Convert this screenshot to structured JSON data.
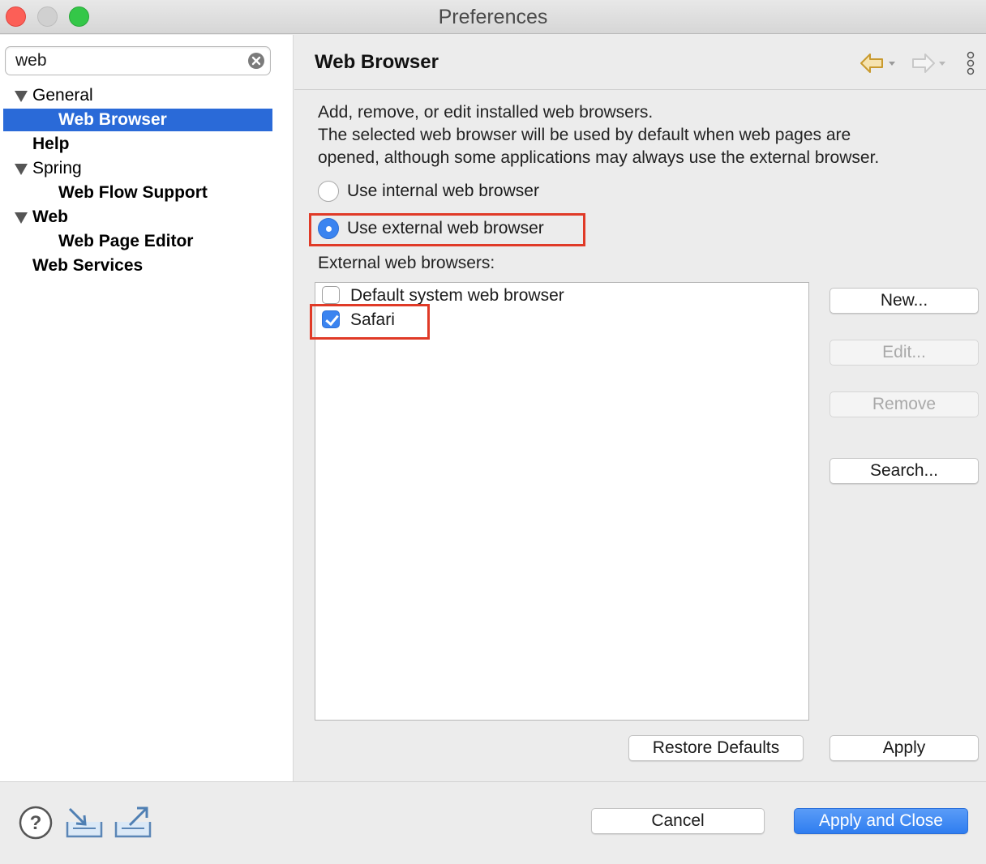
{
  "window": {
    "title": "Preferences"
  },
  "sidebar": {
    "search": {
      "value": "web"
    },
    "items": [
      {
        "label": "General"
      },
      {
        "label": "Web Browser"
      },
      {
        "label": "Help"
      },
      {
        "label": "Spring"
      },
      {
        "label": "Web Flow Support"
      },
      {
        "label": "Web"
      },
      {
        "label": "Web Page Editor"
      },
      {
        "label": "Web Services"
      }
    ],
    "selected": "Web Browser"
  },
  "page": {
    "title": "Web Browser",
    "description_line1": "Add, remove, or edit installed web browsers.",
    "description_line2": "The selected web browser will be used by default when web pages are",
    "description_line3": "opened, although some applications may always use the external browser.",
    "radio_internal": "Use internal web browser",
    "radio_external": "Use external web browser",
    "selected_radio": "Use external web browser",
    "browsers_label": "External web browsers:",
    "browsers": [
      {
        "name": "Default system web browser",
        "checked": false
      },
      {
        "name": "Safari",
        "checked": true
      }
    ]
  },
  "buttons": {
    "new": "New...",
    "edit": "Edit...",
    "remove": "Remove",
    "search": "Search...",
    "restore_defaults": "Restore Defaults",
    "apply": "Apply",
    "cancel": "Cancel",
    "apply_and_close": "Apply and Close"
  },
  "colors": {
    "selection": "#2a6ad8",
    "accent": "#3b84f0",
    "highlight_annotation": "#e03a27"
  },
  "icons": {
    "back": "back-arrow-icon",
    "forward": "forward-arrow-icon",
    "menu": "view-menu-icon",
    "help": "help-icon",
    "import": "import-icon",
    "export": "export-icon",
    "clear": "clear-search-icon"
  }
}
